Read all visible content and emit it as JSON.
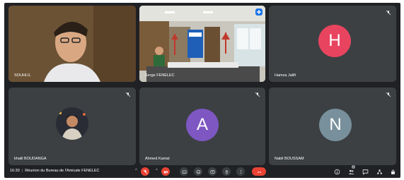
{
  "participants": [
    {
      "name": "SOUHLIL",
      "type": "video",
      "pinned": false
    },
    {
      "name": "Serge FENELEC",
      "type": "video",
      "pinned": true
    },
    {
      "name": "Hamza Jalifi",
      "type": "avatar",
      "initial": "H",
      "color": "#e8445f"
    },
    {
      "name": "khalil BOUDANGA",
      "type": "photo"
    },
    {
      "name": "Ahmed Kamal",
      "type": "avatar",
      "initial": "A",
      "color": "#7e57c2"
    },
    {
      "name": "Nabil BOUSSAM",
      "type": "avatar",
      "initial": "N",
      "color": "#78909c"
    }
  ],
  "meeting": {
    "time": "16:30",
    "separator": "|",
    "title": "Réunion du Bureau de l'Amicale FENELEC"
  },
  "controls": {
    "mic_caret": "^",
    "cam_caret": "^",
    "info_badge": "2"
  },
  "icons": [
    "mic-off-icon",
    "camera-off-icon",
    "captions-icon",
    "emoji-icon",
    "present-icon",
    "raise-hand-icon",
    "more-icon",
    "hangup-icon",
    "info-icon",
    "people-icon",
    "chat-icon",
    "activities-icon",
    "lock-icon"
  ]
}
